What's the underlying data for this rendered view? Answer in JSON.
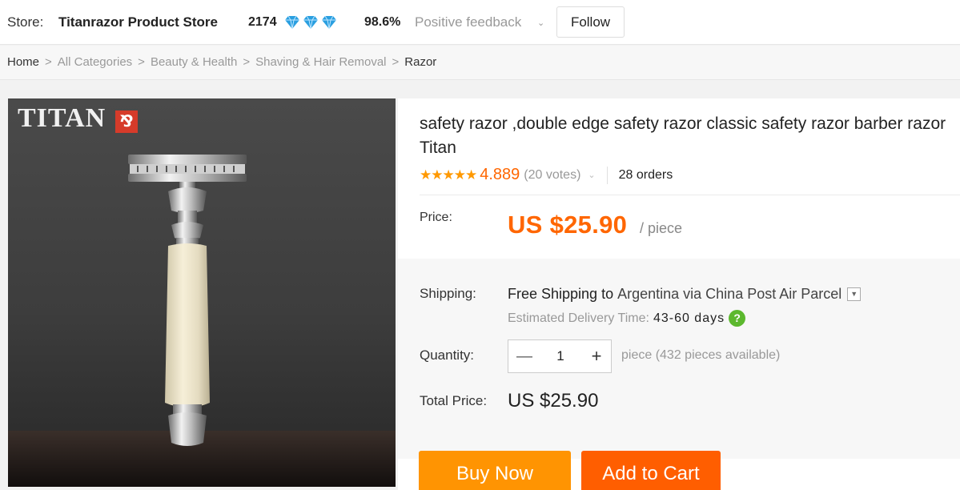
{
  "store": {
    "label": "Store:",
    "name": "Titanrazor Product Store",
    "score": "2174",
    "feedback_pct": "98.6%",
    "feedback_label": "Positive feedback",
    "follow_label": "Follow"
  },
  "breadcrumb": {
    "home": "Home",
    "items": [
      "All Categories",
      "Beauty & Health",
      "Shaving & Hair Removal"
    ],
    "current": "Razor",
    "separator": ">"
  },
  "image": {
    "brand": "TITAN"
  },
  "product": {
    "title": "safety razor ,double edge safety razor classic safety razor barber razor Titan",
    "rating": "4.889",
    "votes": "(20 votes)",
    "orders": "28 orders",
    "stars_filled": 5
  },
  "price": {
    "label": "Price:",
    "value": "US $25.90",
    "unit": "/ piece"
  },
  "shipping": {
    "label": "Shipping:",
    "free": "Free Shipping to",
    "destination": "Argentina via China Post Air Parcel",
    "eta_label": "Estimated Delivery Time:",
    "eta_days": "43-60 days"
  },
  "quantity": {
    "label": "Quantity:",
    "value": "1",
    "available": "piece (432 pieces available)"
  },
  "total": {
    "label": "Total Price:",
    "value": "US $25.90"
  },
  "actions": {
    "buy_now": "Buy Now",
    "add_to_cart": "Add to Cart"
  },
  "colors": {
    "price_accent": "#ff6600",
    "buy_now": "#ff9402",
    "add_to_cart": "#ff5e00",
    "star": "#ff9900",
    "gem": "#2a9fe0",
    "help_badge": "#5cb82e"
  },
  "icons": {
    "gems": [
      "diamond-icon",
      "diamond-icon",
      "diamond-icon"
    ],
    "feedback_chevron": "chevron-down-icon",
    "help": "question-icon"
  }
}
